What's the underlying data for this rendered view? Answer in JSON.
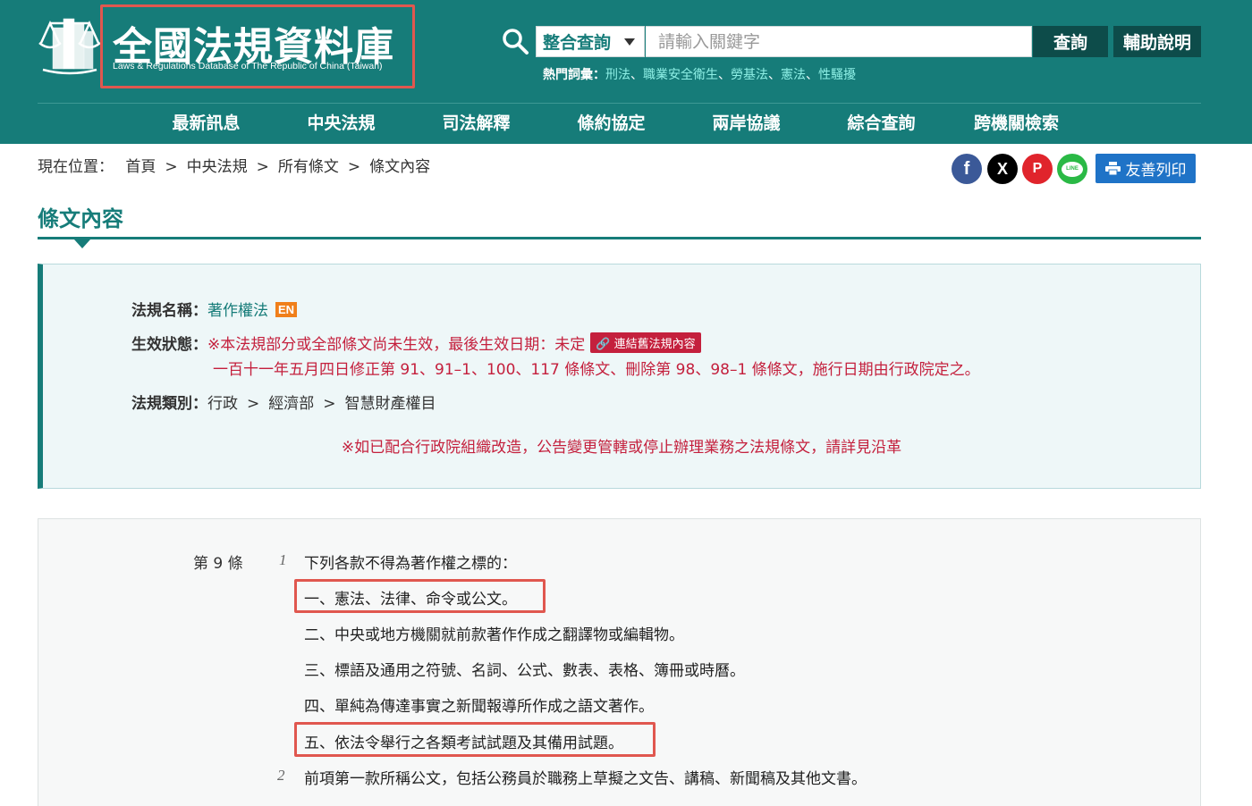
{
  "header": {
    "logo_title": "全國法規資料庫",
    "logo_subtitle": "Laws & Regulations Database of The Republic of China (Taiwan)",
    "search_scope": "整合查詢",
    "search_placeholder": "請輸入關鍵字",
    "query_button": "查詢",
    "help_button": "輔助說明",
    "hot_label": "熱門詞彙：",
    "hot_terms": [
      "刑法",
      "職業安全衛生",
      "勞基法",
      "憲法",
      "性騷擾"
    ],
    "hot_sep": "、"
  },
  "nav": {
    "items": [
      "最新訊息",
      "中央法規",
      "司法解釋",
      "條約協定",
      "兩岸協議",
      "綜合查詢",
      "跨機關檢索"
    ]
  },
  "breadcrumb": {
    "label": "現在位置：",
    "items": [
      "首頁",
      "中央法規",
      "所有條文",
      "條文內容"
    ],
    "arrow": ">"
  },
  "share": {
    "facebook": "f",
    "x": "X",
    "plurk": "P",
    "line": "LINE",
    "print_label": "友善列印"
  },
  "page_title": "條文內容",
  "info": {
    "name_label": "法規名稱：",
    "name_value": "著作權法",
    "en_badge": "EN",
    "status_label": "生效狀態：",
    "status_line1": "※本法規部分或全部條文尚未生效，最後生效日期：未定",
    "status_link": "連結舊法規內容",
    "status_line2": "一百十一年五月四日修正第 91、91–1、100、117 條條文、刪除第 98、98–1  條條文，施行日期由行政院定之。",
    "category_label": "法規類別：",
    "category": [
      "行政",
      "經濟部",
      "智慧財產權目"
    ],
    "category_arrow": ">",
    "notice": "※如已配合行政院組織改造，公告變更管轄或停止辦理業務之法規條文，請詳見沿革"
  },
  "article": {
    "number": "第 9 條",
    "para1_no": "1",
    "para1_intro": "下列各款不得為著作權之標的：",
    "items": [
      "一、憲法、法律、命令或公文。",
      "二、中央或地方機關就前款著作作成之翻譯物或編輯物。",
      "三、標語及通用之符號、名詞、公式、數表、表格、簿冊或時曆。",
      "四、單純為傳達事實之新聞報導所作成之語文著作。",
      "五、依法令舉行之各類考試試題及其備用試題。"
    ],
    "para2_no": "2",
    "para2": "前項第一款所稱公文，包括公務員於職務上草擬之文告、講稿、新聞稿及其他文書。"
  },
  "colors": {
    "header_bg": "#167c79",
    "accent_red": "#c4203d",
    "highlight_box": "#e0574f",
    "print_button": "#1f73c7"
  }
}
